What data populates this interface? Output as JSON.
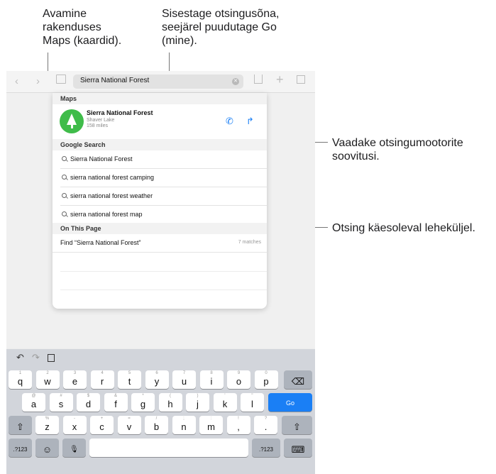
{
  "callouts": {
    "maps": "Avamine\nrakenduses\nMaps (kaardid).",
    "search": "Sisestage otsingusõna,\nseejärel puudutage Go\n(mine).",
    "suggestions": "Vaadake otsingumootorite\nsoovitusi.",
    "on_page": "Otsing käesoleval leheküljel."
  },
  "toolbar": {
    "back_icon": "chevron-left",
    "forward_icon": "chevron-right",
    "bookmarks_icon": "book",
    "url_text": "Sierra National Forest",
    "share_icon": "share",
    "add_icon": "plus",
    "tabs_icon": "tabs"
  },
  "popover": {
    "maps_header": "Maps",
    "maps_result": {
      "title": "Sierra National Forest",
      "subtitle": "Shaver Lake",
      "distance": "158 miles"
    },
    "google_header": "Google Search",
    "suggestions": [
      "Sierra National Forest",
      "sierra national forest camping",
      "sierra national forest weather",
      "sierra national forest map"
    ],
    "page_header": "On This Page",
    "find_label": "Find “Sierra National Forest”",
    "find_count": "7 matches"
  },
  "keyboard": {
    "row1": [
      [
        "1",
        "q"
      ],
      [
        "2",
        "w"
      ],
      [
        "3",
        "e"
      ],
      [
        "4",
        "r"
      ],
      [
        "5",
        "t"
      ],
      [
        "6",
        "y"
      ],
      [
        "7",
        "u"
      ],
      [
        "8",
        "i"
      ],
      [
        "9",
        "o"
      ],
      [
        "0",
        "p"
      ]
    ],
    "row2": [
      [
        "@",
        "a"
      ],
      [
        "#",
        "s"
      ],
      [
        "$",
        "d"
      ],
      [
        "&",
        "f"
      ],
      [
        "*",
        "g"
      ],
      [
        "(",
        "h"
      ],
      [
        ")",
        "j"
      ],
      [
        "'",
        "k"
      ],
      [
        "\"",
        "l"
      ]
    ],
    "row3": [
      [
        "%",
        "z"
      ],
      [
        "-",
        "x"
      ],
      [
        "+",
        "c"
      ],
      [
        "=",
        "v"
      ],
      [
        "/",
        "b"
      ],
      [
        ";",
        "n"
      ],
      [
        ":",
        "m"
      ],
      [
        "",
        ",!"
      ],
      [
        "",
        ".?"
      ]
    ],
    "go_label": "Go",
    "numbers_label": ".?123",
    "accent_color": "#1a7ff5"
  }
}
